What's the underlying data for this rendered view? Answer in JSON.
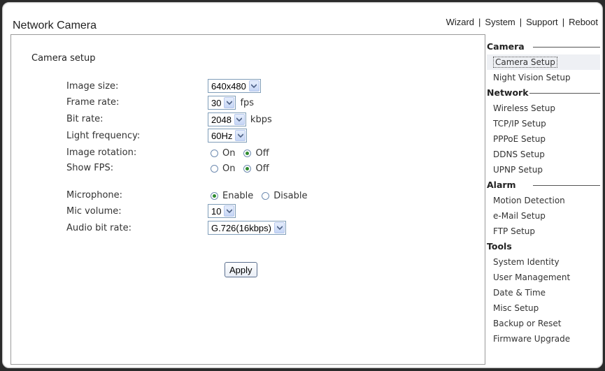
{
  "header": {
    "title": "Network Camera",
    "nav": [
      "Wizard",
      "System",
      "Support",
      "Reboot"
    ]
  },
  "main": {
    "section_title": "Camera setup",
    "fields": {
      "image_size": {
        "label": "Image size:",
        "value": "640x480"
      },
      "frame_rate": {
        "label": "Frame rate:",
        "value": "30",
        "unit": "fps"
      },
      "bit_rate": {
        "label": "Bit rate:",
        "value": "2048",
        "unit": "kbps"
      },
      "light_frequency": {
        "label": "Light frequency:",
        "value": "60Hz"
      },
      "image_rotation": {
        "label": "Image rotation:",
        "options": [
          "On",
          "Off"
        ],
        "selected": "Off"
      },
      "show_fps": {
        "label": "Show FPS:",
        "options": [
          "On",
          "Off"
        ],
        "selected": "Off"
      },
      "microphone": {
        "label": "Microphone:",
        "options": [
          "Enable",
          "Disable"
        ],
        "selected": "Enable"
      },
      "mic_volume": {
        "label": "Mic volume:",
        "value": "10"
      },
      "audio_bit_rate": {
        "label": "Audio bit rate:",
        "value": "G.726(16kbps)"
      }
    },
    "apply_label": "Apply"
  },
  "sidebar": {
    "groups": [
      {
        "title": "Camera",
        "items": [
          "Camera Setup",
          "Night Vision Setup"
        ]
      },
      {
        "title": "Network",
        "items": [
          "Wireless Setup",
          "TCP/IP Setup",
          "PPPoE Setup",
          "DDNS Setup",
          "UPNP Setup"
        ]
      },
      {
        "title": "Alarm",
        "items": [
          "Motion Detection",
          "e-Mail Setup",
          "FTP Setup"
        ]
      },
      {
        "title": "Tools",
        "items": [
          "System Identity",
          "User Management",
          "Date & Time",
          "Misc Setup",
          "Backup or Reset",
          "Firmware Upgrade"
        ]
      }
    ],
    "active_item": "Camera Setup"
  },
  "colors": {
    "radio_selected": "#2e8b2e",
    "select_border": "#7f9db9"
  }
}
